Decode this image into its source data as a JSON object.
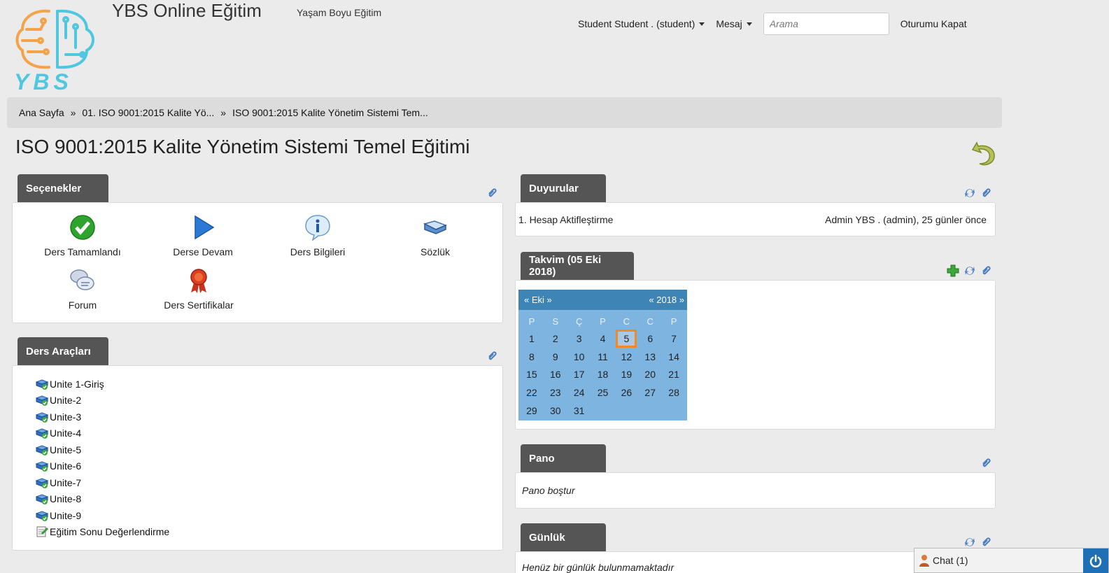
{
  "header": {
    "logo_text": "YBS",
    "site_title": "YBS Online Eğitim",
    "site_subtitle": "Yaşam Boyu Eğitim",
    "user_menu": "Student Student . (student)",
    "messages_menu": "Mesaj",
    "search_placeholder": "Arama",
    "logout": "Oturumu Kapat"
  },
  "breadcrumb": [
    "Ana Sayfa",
    "01. ISO 9001:2015 Kalite Yö...",
    "ISO 9001:2015 Kalite Yönetim Sistemi Tem..."
  ],
  "breadcrumb_sep": "»",
  "page_title": "ISO 9001:2015 Kalite Yönetim Sistemi Temel Eğitimi",
  "options": {
    "title": "Seçenekler",
    "items": [
      {
        "label": "Ders Tamamlandı",
        "icon": "check-icon"
      },
      {
        "label": "Derse Devam",
        "icon": "play-icon"
      },
      {
        "label": "Ders Bilgileri",
        "icon": "info-icon"
      },
      {
        "label": "Sözlük",
        "icon": "book-icon"
      },
      {
        "label": "Forum",
        "icon": "forum-icon"
      },
      {
        "label": "Ders Sertifikalar",
        "icon": "ribbon-icon"
      }
    ]
  },
  "tools": {
    "title": "Ders Araçları",
    "items": [
      "Unite 1-Giriş",
      "Unite-2",
      "Unite-3",
      "Unite-4",
      "Unite-5",
      "Unite-6",
      "Unite-7",
      "Unite-8",
      "Unite-9",
      "Eğitim Sonu Değerlendirme"
    ]
  },
  "announcements": {
    "title": "Duyurular",
    "items": [
      {
        "title": "1. Hesap Aktifleştirme",
        "meta": "Admin YBS . (admin), 25 günler önce"
      }
    ]
  },
  "calendar": {
    "title": "Takvim (05 Eki 2018)",
    "month_nav": "« Eki »",
    "year_nav": "« 2018 »",
    "days_of_week": [
      "P",
      "S",
      "Ç",
      "P",
      "C",
      "C",
      "P"
    ],
    "days": [
      "1",
      "2",
      "3",
      "4",
      "5",
      "6",
      "7",
      "8",
      "9",
      "10",
      "11",
      "12",
      "13",
      "14",
      "15",
      "16",
      "17",
      "18",
      "19",
      "20",
      "21",
      "22",
      "23",
      "24",
      "25",
      "26",
      "27",
      "28",
      "29",
      "30",
      "31"
    ],
    "today": "5"
  },
  "board": {
    "title": "Pano",
    "empty": "Pano boştur"
  },
  "journal": {
    "title": "Günlük",
    "empty": "Henüz bir günlük bulunmamaktadır"
  },
  "chat": {
    "label": "Chat (1)"
  },
  "colors": {
    "tab_bg": "#555555",
    "calendar_header": "#3e84b5",
    "calendar_body": "#7eb4e0",
    "today_border": "#f08a24",
    "chat_power": "#1f6fb7"
  }
}
